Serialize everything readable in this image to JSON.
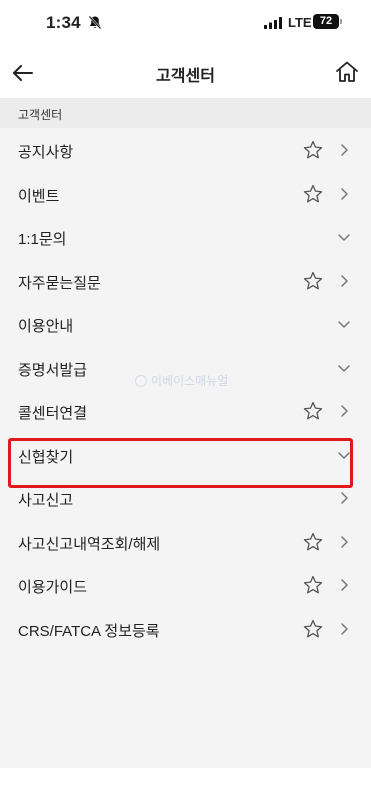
{
  "status_bar": {
    "time": "1:34",
    "network": "LTE",
    "battery": "72"
  },
  "header": {
    "title": "고객센터"
  },
  "section": {
    "title": "고객센터"
  },
  "items": [
    {
      "label": "공지사항",
      "star": true,
      "chevron": "right"
    },
    {
      "label": "이벤트",
      "star": true,
      "chevron": "right"
    },
    {
      "label": "1:1문의",
      "star": false,
      "chevron": "down"
    },
    {
      "label": "자주묻는질문",
      "star": true,
      "chevron": "right"
    },
    {
      "label": "이용안내",
      "star": false,
      "chevron": "down"
    },
    {
      "label": "증명서발급",
      "star": false,
      "chevron": "down"
    },
    {
      "label": "콜센터연결",
      "star": true,
      "chevron": "right"
    },
    {
      "label": "신협찾기",
      "star": false,
      "chevron": "down"
    },
    {
      "label": "사고신고",
      "star": false,
      "chevron": "right"
    },
    {
      "label": "사고신고내역조회/해제",
      "star": true,
      "chevron": "right"
    },
    {
      "label": "이용가이드",
      "star": true,
      "chevron": "right"
    },
    {
      "label": "CRS/FATCA 정보등록",
      "star": true,
      "chevron": "right"
    }
  ],
  "watermark": "이베이스매뉴얼",
  "icons": {
    "back": "back-arrow-icon",
    "home": "home-icon",
    "star": "star-outline-icon",
    "chevron_right": "chevron-right-icon",
    "chevron_down": "chevron-down-icon"
  },
  "colors": {
    "highlight": "#e1191f",
    "background": "#f4f4f4"
  }
}
